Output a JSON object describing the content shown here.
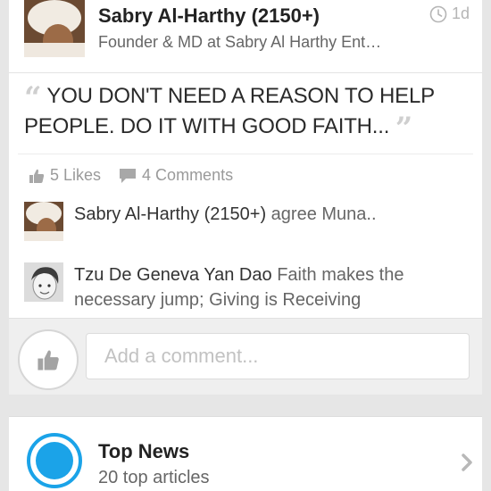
{
  "post": {
    "author": {
      "name": "Sabry Al-Harthy (2150+)",
      "title": "Founder & MD at Sabry Al Harthy Ent…",
      "time": "1d"
    },
    "quote": "YOU DON'T NEED A REASON TO HELP PEOPLE. DO IT WITH GOOD FAITH...",
    "stats": {
      "likes": "5 Likes",
      "comments": "4 Comments"
    },
    "comments": [
      {
        "author": "Sabry Al-Harthy (2150+)",
        "text": "agree Muna.."
      },
      {
        "author": "Tzu De Geneva Yan Dao",
        "text": "Faith makes the necessary jump; Giving is Receiving"
      }
    ],
    "compose": {
      "placeholder": "Add a comment..."
    }
  },
  "news": {
    "title": "Top News",
    "subtitle": "20 top articles"
  },
  "colors": {
    "accent": "#1ba3e8",
    "muted": "#9a9a9a",
    "background": "#e6e6e6"
  },
  "icons": [
    "clock-icon",
    "thumbs-up-icon",
    "speech-bubble-icon",
    "chevron-right-icon",
    "top-news-logo-icon"
  ]
}
